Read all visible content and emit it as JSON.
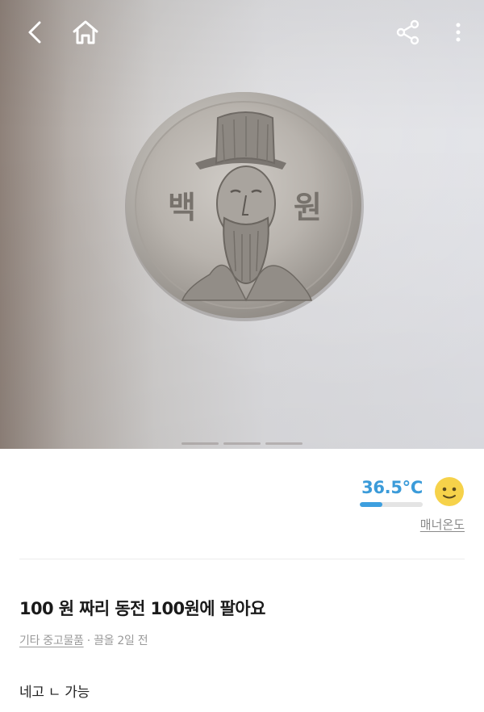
{
  "post": {
    "title": "100 원 짜리 동전 100원에 팔아요",
    "category": "기타 중고물품",
    "separator": " · ",
    "time": "끌올 2일 전",
    "body": "네고 ㄴ 가능"
  },
  "photo": {
    "coin_left_text": "백",
    "coin_right_text": "원",
    "dots_count": 3
  },
  "seller": {
    "temperature": "36.5°C",
    "temperature_fill_percent": 36.5,
    "manner_label": "매너온도"
  },
  "icons": {
    "back": "chevron-left-icon",
    "home": "home-icon",
    "share": "share-icon",
    "more": "more-vertical-icon",
    "face": "smiley-face-icon"
  },
  "colors": {
    "accent_blue": "#3b9bd9",
    "face_yellow": "#f6d24a"
  }
}
